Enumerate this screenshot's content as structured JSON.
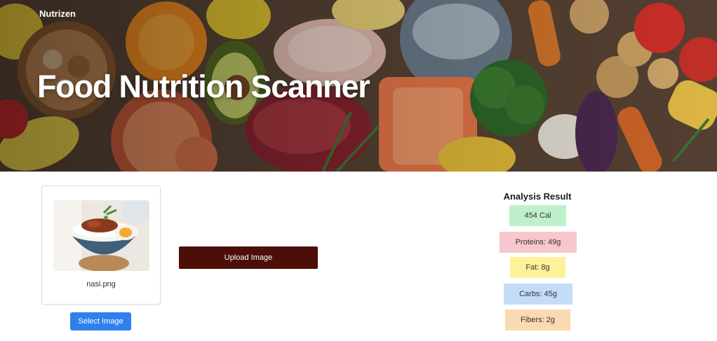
{
  "app": {
    "brand": "Nutrizen"
  },
  "hero": {
    "title": "Food Nutrition Scanner"
  },
  "preview": {
    "filename": "nasi.png"
  },
  "buttons": {
    "select": "Select Image",
    "upload": "Upload Image"
  },
  "results": {
    "title": "Analysis Result",
    "calories": "454 Cal",
    "proteins": "Proteins: 49g",
    "fat": "Fat: 8g",
    "carbs": "Carbs: 45g",
    "fibers": "Fibers: 2g"
  },
  "colors": {
    "upload_button": "#4b0f08",
    "select_button": "#2f80ed",
    "calories_chip": "#bff0cc",
    "proteins_chip": "#f8c7cd",
    "fat_chip": "#fdf29a",
    "carbs_chip": "#c4dcf7",
    "fibers_chip": "#fbd9b2"
  }
}
